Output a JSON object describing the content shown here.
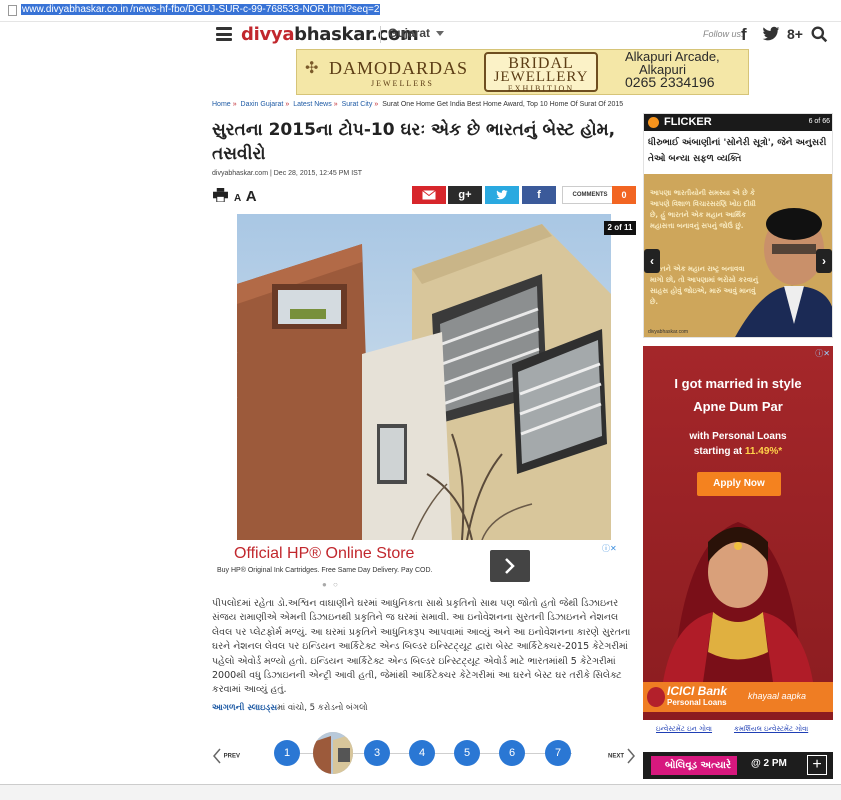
{
  "browser": {
    "url_host": "www.divyabhaskar.co.in",
    "url_path": "/news-hf-fbo/DGUJ-SUR-c-99-768533-NOR.html?seq=2"
  },
  "header": {
    "logo_part1": "divya",
    "logo_part2": "bhaskar.com",
    "state": "Gujarat",
    "follow_label": "Follow us:",
    "facebook_glyph": "f",
    "googleplus_glyph": "8+"
  },
  "top_banner": {
    "brand": "DAMODARDAS",
    "brand_sub": "JEWELLERS",
    "event_line1": "BRIDAL",
    "event_line2": "JEWELLERY",
    "event_line3": "EXHIBITION",
    "address_line1": "Alkapuri Arcade,",
    "address_line2": "Alkapuri",
    "phone": "0265 2334196"
  },
  "breadcrumb": {
    "items": [
      "Home",
      "Daxin Gujarat",
      "Latest News",
      "Surat City"
    ],
    "current": "Surat One Home Get India Best Home Award, Top 10 Home Of Surat Of 2015",
    "separator": "»"
  },
  "article": {
    "title": "સુરતના 2015ના ટોપ-10 ઘરઃ એક છે ભારતનું બેસ્ટ હોમ, તસવીરો",
    "source": "divyabhaskar.com",
    "date": "Dec 28, 2015, 12:45 PM IST",
    "font_small": "A",
    "font_large": "A",
    "share_gplus": "g+",
    "comments_label": "COMMENTS",
    "comments_count": "0",
    "slide_counter": "2 of 11",
    "body": "પીપલોદમાં રહેતા ડો.અશ્વિન વાઘાણીને ઘરમાં આધુનિકતા સાથે પ્રકૃતિનો સાથ પણ જોતો હતો જેથી ડિઝાઇનર સંજય રામાણીએ એમની ડિઝાઇનથી પ્રકૃતિને જ ઘરમાં સમાવી. આ ઇનોવેશનના સુરતની ડિઝાઇનને નેશનલ લેવલ પર પ્લેટફોર્મ મળ્યું. આ ઘરમાં પ્રકૃતિને આધુનિકરૂપ આપવામાં આવ્યું અને આ ઇનોવેશનના કારણે સુરતના ઘરને નેશનલ લેવલ પર ઇન્ડિયન આર્કિટેક્ટ એન્ડ બિલ્ડર ઇન્સ્ટિટ્યૂટ દ્વારા બેસ્ટ આર્કિટેક્ચર-2015 કેટેગરીમાં પહેલો એવોર્ડ મળ્યો હતો. ઇન્ડિયન આર્કિટેક્ટ એન્ડ બિલ્ડર ઇન્સ્ટિટ્યૂટ એવોર્ડ માટે ભારતમાંથી 5 કેટેગરીમાં 2000થી વધુ ડિઝાઇનની એન્ટ્રી આવી હતી, જેમાંથી આર્કિટેક્ચર કેટેગરીમાં આ ઘરને બેસ્ટ ઘર તરીકે સિલેક્ટ કરવામાં આવ્યું હતું.",
    "more_link": "આગળની સ્લાઇડ્સ",
    "more_text": "માં વાંચો, 5 કરોડનો બંગલો"
  },
  "inline_ad": {
    "headline": "Official HP® Online Store",
    "subline": "Buy HP® Original Ink Cartridges. Free Same Day Delivery. Pay COD."
  },
  "pager": {
    "prev_label": "PREV",
    "next_label": "NEXT",
    "pages": [
      "1",
      "3",
      "4",
      "5",
      "6",
      "7"
    ]
  },
  "flicker": {
    "title": "FLICKER",
    "count": "6 of 66",
    "caption": "ધીરુભાઈ અંબાણીનાં 'સોનેરી સૂત્રો', જેને અનુસરી તેઓ બન્યા સફળ વ્યક્તિ",
    "quote_top": "આપણા ભારતીયોની સમસ્યા એ છે કે આપણે વિશાળ વિચારસરણિ ખોઇ દીધી છે, હું ભારતને એક મહાન આર્થિક મહાસત્તા બનાવનું સપનું જોઉં છું.",
    "quote_bottom": "ભારતને એક મહાન રાષ્ટ્ર બનાવવા માગો છો, તો આપણામાં ભરોસો કરવાનું સાહસ હોવું જોઇએ, મારું આવું માનવું છે.",
    "credit": "divyabhaskar.com"
  },
  "icici_ad": {
    "headline_line1": "I got married in style",
    "headline_line2": "Apne Dum Par",
    "sub_line1": "with Personal Loans",
    "sub_line2_prefix": "starting at ",
    "rate": "11.49%*",
    "cta": "Apply Now",
    "brand": "ICICI Bank",
    "brand_sub": "Personal Loans",
    "tagline": "khayaal aapka"
  },
  "invest_links": [
    "ઇન્વેસ્ટમેંટ ઇન ગોવા",
    "કમર્શિયલ ઇન્વેસ્ટમેંટ ગોવા"
  ],
  "bollywood": {
    "label": "બોલિવૂડ અત્યારે",
    "time": "@ 2 PM",
    "plus": "+"
  },
  "colors": {
    "brand_red": "#c1272d",
    "link_blue": "#1f5ba5",
    "pager_blue": "#2a77d4",
    "comment_orange": "#f26522",
    "mail_red": "#d7262b",
    "gplus_dark": "#2b2b2b",
    "twitter_blue": "#2aa9e0",
    "facebook_blue": "#3b5a9a"
  }
}
